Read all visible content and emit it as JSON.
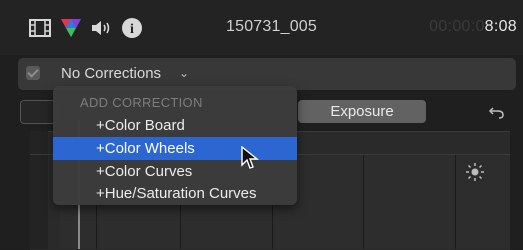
{
  "header": {
    "clip_name": "150731_005",
    "timecode_dim": "00:00:0",
    "timecode_bright": "8:08",
    "icons": [
      "film-icon",
      "color-prism-icon",
      "speaker-icon",
      "info-icon"
    ]
  },
  "corrections": {
    "enabled": true,
    "label": "No Corrections",
    "chevron": "⌄"
  },
  "tabs": {
    "exposure_label": "Exposure"
  },
  "menu": {
    "header": "ADD CORRECTION",
    "items": [
      {
        "label": "+Color Board",
        "selected": false
      },
      {
        "label": "+Color Wheels",
        "selected": true
      },
      {
        "label": "+Color Curves",
        "selected": false
      },
      {
        "label": "+Hue/Saturation Curves",
        "selected": false
      }
    ]
  },
  "colors": {
    "selection": "#2c67d1",
    "background": "#1f1f1f"
  }
}
